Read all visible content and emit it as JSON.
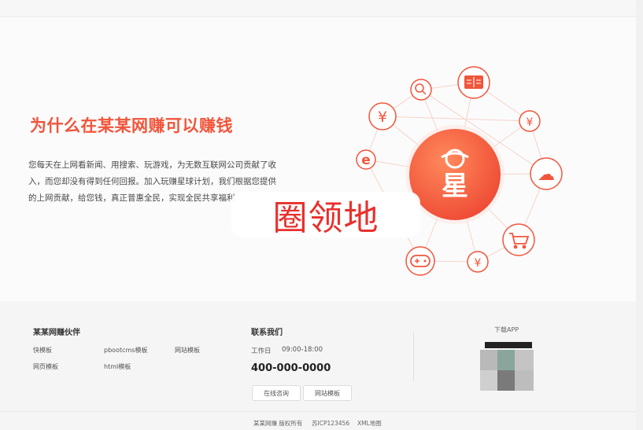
{
  "hero": {
    "title": "为什么在某某网赚可以赚钱",
    "description": "您每天在上网看新闻、用搜索、玩游戏，为无数互联网公司贡献了收入，而您却没有得到任何回报。加入玩赚星球计划，我们根据您提供的上网贡献，给您钱，真正普惠全民，实现全民共享福利"
  },
  "watermark": {
    "text": "圈领地"
  },
  "diagram": {
    "center_label": "星",
    "nodes": [
      {
        "name": "search",
        "glyph": "⚲"
      },
      {
        "name": "book",
        "glyph": "▭"
      },
      {
        "name": "yuan",
        "glyph": "¥"
      },
      {
        "name": "yuan",
        "glyph": "¥"
      },
      {
        "name": "ie-browser",
        "glyph": "e"
      },
      {
        "name": "cloud",
        "glyph": "☁"
      },
      {
        "name": "cart",
        "glyph": "⛟"
      },
      {
        "name": "gamepad",
        "glyph": "◉"
      },
      {
        "name": "yuan",
        "glyph": "¥"
      }
    ],
    "accent_color": "#f1553b"
  },
  "footer": {
    "partners_title": "某某网赚伙伴",
    "partners": [
      "快模板",
      "pbootcms模板",
      "网站模板",
      "网页模板",
      "html模板"
    ],
    "contact_title": "联系我们",
    "hours_label": "工作日",
    "hours_value": "09:00-18:00",
    "phone": "400-000-0000",
    "buttons": [
      "在线咨询",
      "网站模板"
    ],
    "app_label": "下载APP",
    "copyright": "某某网赚 版权所有",
    "icp": "苏ICP123456",
    "sitemap": "XML地图"
  }
}
